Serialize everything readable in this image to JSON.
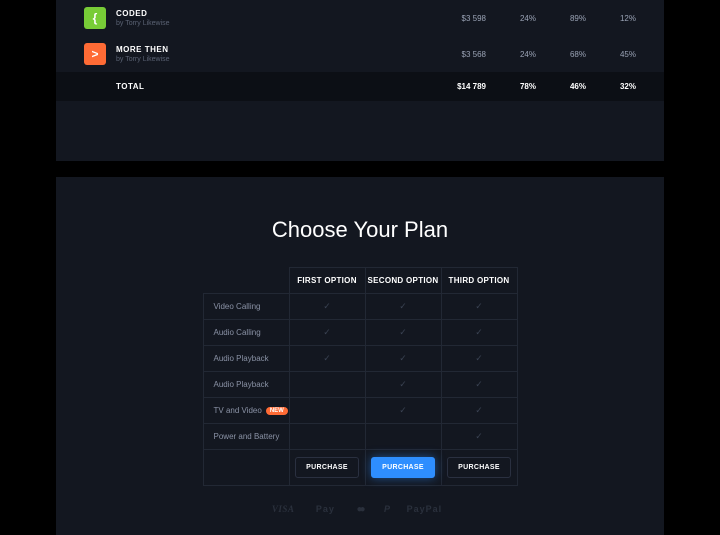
{
  "tracks": [
    {
      "icon": "{",
      "iconClass": "ic-green",
      "title": "CODED",
      "by": "by Torry Likewise",
      "amount": "$3 598",
      "c1": "24%",
      "c2": "89%",
      "c3": "12%"
    },
    {
      "icon": ">",
      "iconClass": "ic-orange",
      "title": "MORE THEN",
      "by": "by Torry Likewise",
      "amount": "$3 568",
      "c1": "24%",
      "c2": "68%",
      "c3": "45%"
    }
  ],
  "total": {
    "label": "TOTAL",
    "amount": "$14 789",
    "c1": "78%",
    "c2": "46%",
    "c3": "32%"
  },
  "plan": {
    "title": "Choose Your Plan",
    "cols": [
      "FIRST OPTION",
      "SECOND OPTION",
      "THIRD OPTION"
    ],
    "rows": [
      {
        "feat": "Video Calling",
        "badge": "",
        "v": [
          true,
          true,
          true
        ]
      },
      {
        "feat": "Audio Calling",
        "badge": "",
        "v": [
          true,
          true,
          true
        ]
      },
      {
        "feat": "Audio Playback",
        "badge": "",
        "v": [
          true,
          true,
          true
        ]
      },
      {
        "feat": "Audio Playback",
        "badge": "",
        "v": [
          false,
          true,
          true
        ]
      },
      {
        "feat": "TV and Video",
        "badge": "NEW",
        "v": [
          false,
          true,
          true
        ]
      },
      {
        "feat": "Power and Battery",
        "badge": "",
        "v": [
          false,
          false,
          true
        ]
      }
    ],
    "purchase": "PURCHASE",
    "primaryIndex": 1
  },
  "payments": [
    "VISA",
    "Pay",
    "mc",
    "PayPal"
  ]
}
